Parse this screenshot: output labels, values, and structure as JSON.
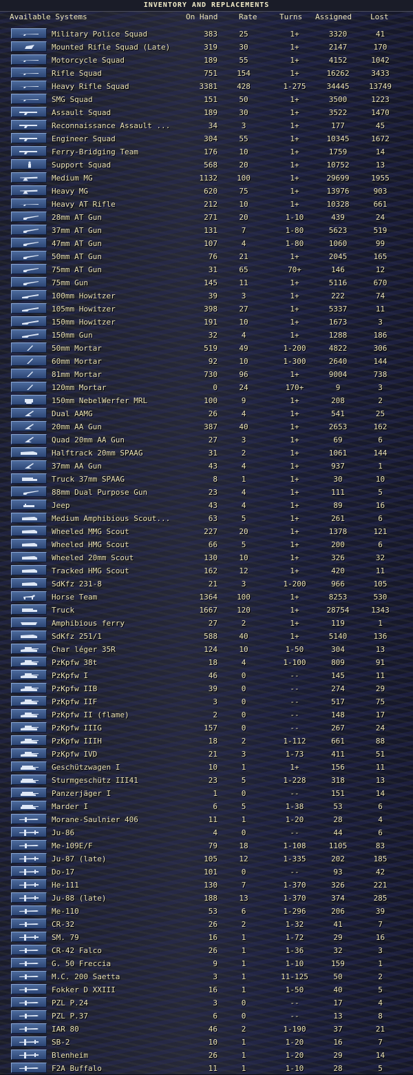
{
  "window": {
    "title": "INVENTORY AND REPLACEMENTS"
  },
  "header": {
    "systems": "Available Systems",
    "on_hand": "On Hand",
    "rate": "Rate",
    "turns": "Turns",
    "assigned": "Assigned",
    "lost": "Lost"
  },
  "rows": [
    {
      "icon": "infantry-icon",
      "name": "Military Police Squad",
      "on_hand": "383",
      "rate": "25",
      "turns": "1+",
      "assigned": "3320",
      "lost": "41"
    },
    {
      "icon": "cavalry-icon",
      "name": "Mounted Rifle Squad (Late)",
      "on_hand": "319",
      "rate": "30",
      "turns": "1+",
      "assigned": "2147",
      "lost": "170"
    },
    {
      "icon": "infantry-icon",
      "name": "Motorcycle Squad",
      "on_hand": "189",
      "rate": "55",
      "turns": "1+",
      "assigned": "4152",
      "lost": "1042"
    },
    {
      "icon": "infantry-icon",
      "name": "Rifle Squad",
      "on_hand": "751",
      "rate": "154",
      "turns": "1+",
      "assigned": "16262",
      "lost": "3433"
    },
    {
      "icon": "infantry-icon",
      "name": "Heavy Rifle Squad",
      "on_hand": "3381",
      "rate": "428",
      "turns": "1-275",
      "assigned": "34445",
      "lost": "13749"
    },
    {
      "icon": "infantry-icon",
      "name": "SMG Squad",
      "on_hand": "151",
      "rate": "50",
      "turns": "1+",
      "assigned": "3500",
      "lost": "1223"
    },
    {
      "icon": "assault-icon",
      "name": "Assault Squad",
      "on_hand": "189",
      "rate": "30",
      "turns": "1+",
      "assigned": "3522",
      "lost": "1470"
    },
    {
      "icon": "assault-icon",
      "name": "Reconnaissance Assault ...",
      "on_hand": "34",
      "rate": "3",
      "turns": "1+",
      "assigned": "177",
      "lost": "45"
    },
    {
      "icon": "assault-icon",
      "name": "Engineer Squad",
      "on_hand": "304",
      "rate": "55",
      "turns": "1+",
      "assigned": "10345",
      "lost": "1672"
    },
    {
      "icon": "assault-icon",
      "name": "Ferry-Bridging Team",
      "on_hand": "176",
      "rate": "10",
      "turns": "1+",
      "assigned": "1759",
      "lost": "14"
    },
    {
      "icon": "soldier-icon",
      "name": "Support Squad",
      "on_hand": "568",
      "rate": "20",
      "turns": "1+",
      "assigned": "10752",
      "lost": "13"
    },
    {
      "icon": "machinegun-icon",
      "name": "Medium MG",
      "on_hand": "1132",
      "rate": "100",
      "turns": "1+",
      "assigned": "29699",
      "lost": "1955"
    },
    {
      "icon": "machinegun-icon",
      "name": "Heavy MG",
      "on_hand": "620",
      "rate": "75",
      "turns": "1+",
      "assigned": "13976",
      "lost": "903"
    },
    {
      "icon": "infantry-icon",
      "name": "Heavy AT Rifle",
      "on_hand": "212",
      "rate": "10",
      "turns": "1+",
      "assigned": "10328",
      "lost": "661"
    },
    {
      "icon": "atgun-icon",
      "name": "28mm AT Gun",
      "on_hand": "271",
      "rate": "20",
      "turns": "1-10",
      "assigned": "439",
      "lost": "24"
    },
    {
      "icon": "atgun-icon",
      "name": "37mm AT Gun",
      "on_hand": "131",
      "rate": "7",
      "turns": "1-80",
      "assigned": "5623",
      "lost": "519"
    },
    {
      "icon": "atgun-icon",
      "name": "47mm AT Gun",
      "on_hand": "107",
      "rate": "4",
      "turns": "1-80",
      "assigned": "1060",
      "lost": "99"
    },
    {
      "icon": "atgun-icon",
      "name": "50mm AT Gun",
      "on_hand": "76",
      "rate": "21",
      "turns": "1+",
      "assigned": "2045",
      "lost": "165"
    },
    {
      "icon": "atgun-icon",
      "name": "75mm AT Gun",
      "on_hand": "31",
      "rate": "65",
      "turns": "70+",
      "assigned": "146",
      "lost": "12"
    },
    {
      "icon": "atgun-icon",
      "name": "75mm Gun",
      "on_hand": "145",
      "rate": "11",
      "turns": "1+",
      "assigned": "5116",
      "lost": "670"
    },
    {
      "icon": "howitzer-icon",
      "name": "100mm Howitzer",
      "on_hand": "39",
      "rate": "3",
      "turns": "1+",
      "assigned": "222",
      "lost": "74"
    },
    {
      "icon": "howitzer-icon",
      "name": "105mm Howitzer",
      "on_hand": "398",
      "rate": "27",
      "turns": "1+",
      "assigned": "5337",
      "lost": "11"
    },
    {
      "icon": "howitzer-icon",
      "name": "150mm Howitzer",
      "on_hand": "191",
      "rate": "10",
      "turns": "1+",
      "assigned": "1673",
      "lost": "3"
    },
    {
      "icon": "howitzer-icon",
      "name": "150mm Gun",
      "on_hand": "32",
      "rate": "4",
      "turns": "1+",
      "assigned": "1288",
      "lost": "186"
    },
    {
      "icon": "mortar-icon",
      "name": "50mm Mortar",
      "on_hand": "519",
      "rate": "49",
      "turns": "1-200",
      "assigned": "4822",
      "lost": "306"
    },
    {
      "icon": "mortar-icon",
      "name": "60mm Mortar",
      "on_hand": "92",
      "rate": "10",
      "turns": "1-300",
      "assigned": "2640",
      "lost": "144"
    },
    {
      "icon": "mortar-icon",
      "name": "81mm Mortar",
      "on_hand": "730",
      "rate": "96",
      "turns": "1+",
      "assigned": "9004",
      "lost": "738"
    },
    {
      "icon": "mortar-icon",
      "name": "120mm Mortar",
      "on_hand": "0",
      "rate": "24",
      "turns": "170+",
      "assigned": "9",
      "lost": "3"
    },
    {
      "icon": "rocket-icon",
      "name": "150mm NebelWerfer MRL",
      "on_hand": "100",
      "rate": "9",
      "turns": "1+",
      "assigned": "208",
      "lost": "2"
    },
    {
      "icon": "aa-gun-icon",
      "name": "Dual AAMG",
      "on_hand": "26",
      "rate": "4",
      "turns": "1+",
      "assigned": "541",
      "lost": "25"
    },
    {
      "icon": "aa-gun-icon",
      "name": "20mm AA Gun",
      "on_hand": "387",
      "rate": "40",
      "turns": "1+",
      "assigned": "2653",
      "lost": "162"
    },
    {
      "icon": "aa-gun-icon",
      "name": "Quad 20mm AA Gun",
      "on_hand": "27",
      "rate": "3",
      "turns": "1+",
      "assigned": "69",
      "lost": "6"
    },
    {
      "icon": "halftrack-icon",
      "name": "Halftrack 20mm SPAAG",
      "on_hand": "31",
      "rate": "2",
      "turns": "1+",
      "assigned": "1061",
      "lost": "144"
    },
    {
      "icon": "aa-gun-icon",
      "name": "37mm AA Gun",
      "on_hand": "43",
      "rate": "4",
      "turns": "1+",
      "assigned": "937",
      "lost": "1"
    },
    {
      "icon": "truck-icon",
      "name": "Truck 37mm SPAAG",
      "on_hand": "8",
      "rate": "1",
      "turns": "1+",
      "assigned": "30",
      "lost": "10"
    },
    {
      "icon": "atgun-icon",
      "name": "88mm Dual Purpose Gun",
      "on_hand": "23",
      "rate": "4",
      "turns": "1+",
      "assigned": "111",
      "lost": "5"
    },
    {
      "icon": "jeep-icon",
      "name": "Jeep",
      "on_hand": "43",
      "rate": "4",
      "turns": "1+",
      "assigned": "89",
      "lost": "16"
    },
    {
      "icon": "armored-car-icon",
      "name": "Medium Amphibious Scout...",
      "on_hand": "63",
      "rate": "5",
      "turns": "1+",
      "assigned": "261",
      "lost": "6"
    },
    {
      "icon": "armored-car-icon",
      "name": "Wheeled MMG Scout",
      "on_hand": "227",
      "rate": "20",
      "turns": "1+",
      "assigned": "1378",
      "lost": "121"
    },
    {
      "icon": "armored-car-icon",
      "name": "Wheeled HMG Scout",
      "on_hand": "66",
      "rate": "5",
      "turns": "1+",
      "assigned": "200",
      "lost": "6"
    },
    {
      "icon": "armored-car-icon",
      "name": "Wheeled 20mm Scout",
      "on_hand": "130",
      "rate": "10",
      "turns": "1+",
      "assigned": "326",
      "lost": "32"
    },
    {
      "icon": "armored-car-icon",
      "name": "Tracked HMG Scout",
      "on_hand": "162",
      "rate": "12",
      "turns": "1+",
      "assigned": "420",
      "lost": "11"
    },
    {
      "icon": "armored-car-icon",
      "name": "SdKfz 231-8",
      "on_hand": "21",
      "rate": "3",
      "turns": "1-200",
      "assigned": "966",
      "lost": "105"
    },
    {
      "icon": "horse-icon",
      "name": "Horse Team",
      "on_hand": "1364",
      "rate": "100",
      "turns": "1+",
      "assigned": "8253",
      "lost": "530"
    },
    {
      "icon": "truck-icon",
      "name": "Truck",
      "on_hand": "1667",
      "rate": "120",
      "turns": "1+",
      "assigned": "28754",
      "lost": "1343"
    },
    {
      "icon": "ferry-icon",
      "name": "Amphibious ferry",
      "on_hand": "27",
      "rate": "2",
      "turns": "1+",
      "assigned": "119",
      "lost": "1"
    },
    {
      "icon": "halftrack-icon",
      "name": "SdKfz 251/1",
      "on_hand": "588",
      "rate": "40",
      "turns": "1+",
      "assigned": "5140",
      "lost": "136"
    },
    {
      "icon": "tank-icon",
      "name": "Char léger 35R",
      "on_hand": "124",
      "rate": "10",
      "turns": "1-50",
      "assigned": "304",
      "lost": "13"
    },
    {
      "icon": "tank-icon",
      "name": "PzKpfw 38t",
      "on_hand": "18",
      "rate": "4",
      "turns": "1-100",
      "assigned": "809",
      "lost": "91"
    },
    {
      "icon": "tank-icon",
      "name": "PzKpfw I",
      "on_hand": "46",
      "rate": "0",
      "turns": "--",
      "assigned": "145",
      "lost": "11"
    },
    {
      "icon": "tank-icon",
      "name": "PzKpfw IIB",
      "on_hand": "39",
      "rate": "0",
      "turns": "--",
      "assigned": "274",
      "lost": "29"
    },
    {
      "icon": "tank-icon",
      "name": "PzKpfw IIF",
      "on_hand": "3",
      "rate": "0",
      "turns": "--",
      "assigned": "517",
      "lost": "75"
    },
    {
      "icon": "tank-icon",
      "name": "PzKpfw II (flame)",
      "on_hand": "2",
      "rate": "0",
      "turns": "--",
      "assigned": "148",
      "lost": "17"
    },
    {
      "icon": "tank-icon",
      "name": "PzKpfw IIIG",
      "on_hand": "157",
      "rate": "0",
      "turns": "--",
      "assigned": "267",
      "lost": "24"
    },
    {
      "icon": "tank-icon",
      "name": "PzKpfw IIIH",
      "on_hand": "18",
      "rate": "2",
      "turns": "1-112",
      "assigned": "661",
      "lost": "88"
    },
    {
      "icon": "tank-icon",
      "name": "PzKpfw IVD",
      "on_hand": "21",
      "rate": "3",
      "turns": "1-73",
      "assigned": "411",
      "lost": "51"
    },
    {
      "icon": "assault-gun-icon",
      "name": "Geschützwagen I",
      "on_hand": "10",
      "rate": "1",
      "turns": "1+",
      "assigned": "156",
      "lost": "11"
    },
    {
      "icon": "assault-gun-icon",
      "name": "Sturmgeschütz III41",
      "on_hand": "23",
      "rate": "5",
      "turns": "1-228",
      "assigned": "318",
      "lost": "13"
    },
    {
      "icon": "assault-gun-icon",
      "name": "Panzerjäger I",
      "on_hand": "1",
      "rate": "0",
      "turns": "--",
      "assigned": "151",
      "lost": "14"
    },
    {
      "icon": "assault-gun-icon",
      "name": "Marder I",
      "on_hand": "6",
      "rate": "5",
      "turns": "1-38",
      "assigned": "53",
      "lost": "6"
    },
    {
      "icon": "fighter-icon",
      "name": "Morane-Saulnier 406",
      "on_hand": "11",
      "rate": "1",
      "turns": "1-20",
      "assigned": "28",
      "lost": "4"
    },
    {
      "icon": "bomber-icon",
      "name": "Ju-86",
      "on_hand": "4",
      "rate": "0",
      "turns": "--",
      "assigned": "44",
      "lost": "6"
    },
    {
      "icon": "fighter-icon",
      "name": "Me-109E/F",
      "on_hand": "79",
      "rate": "18",
      "turns": "1-108",
      "assigned": "1105",
      "lost": "83"
    },
    {
      "icon": "bomber-icon",
      "name": "Ju-87 (late)",
      "on_hand": "105",
      "rate": "12",
      "turns": "1-335",
      "assigned": "202",
      "lost": "185"
    },
    {
      "icon": "bomber-icon",
      "name": "Do-17",
      "on_hand": "101",
      "rate": "0",
      "turns": "--",
      "assigned": "93",
      "lost": "42"
    },
    {
      "icon": "bomber-icon",
      "name": "He-111",
      "on_hand": "130",
      "rate": "7",
      "turns": "1-370",
      "assigned": "326",
      "lost": "221"
    },
    {
      "icon": "bomber-icon",
      "name": "Ju-88 (late)",
      "on_hand": "188",
      "rate": "13",
      "turns": "1-370",
      "assigned": "374",
      "lost": "285"
    },
    {
      "icon": "fighter-icon",
      "name": "Me-110",
      "on_hand": "53",
      "rate": "6",
      "turns": "1-296",
      "assigned": "206",
      "lost": "39"
    },
    {
      "icon": "fighter-icon",
      "name": "CR-32",
      "on_hand": "26",
      "rate": "2",
      "turns": "1-32",
      "assigned": "41",
      "lost": "7"
    },
    {
      "icon": "bomber-icon",
      "name": "SM. 79",
      "on_hand": "16",
      "rate": "1",
      "turns": "1-72",
      "assigned": "29",
      "lost": "16"
    },
    {
      "icon": "fighter-icon",
      "name": "CR-42 Falco",
      "on_hand": "26",
      "rate": "1",
      "turns": "1-36",
      "assigned": "32",
      "lost": "3"
    },
    {
      "icon": "fighter-icon",
      "name": "G. 50 Freccia",
      "on_hand": "9",
      "rate": "1",
      "turns": "1-10",
      "assigned": "159",
      "lost": "1"
    },
    {
      "icon": "fighter-icon",
      "name": "M.C. 200 Saetta",
      "on_hand": "3",
      "rate": "1",
      "turns": "11-125",
      "assigned": "50",
      "lost": "2"
    },
    {
      "icon": "fighter-icon",
      "name": "Fokker D XXIII",
      "on_hand": "16",
      "rate": "1",
      "turns": "1-50",
      "assigned": "40",
      "lost": "5"
    },
    {
      "icon": "fighter-icon",
      "name": "PZL P.24",
      "on_hand": "3",
      "rate": "0",
      "turns": "--",
      "assigned": "17",
      "lost": "4"
    },
    {
      "icon": "fighter-icon",
      "name": "PZL P.37",
      "on_hand": "6",
      "rate": "0",
      "turns": "--",
      "assigned": "13",
      "lost": "8"
    },
    {
      "icon": "fighter-icon",
      "name": "IAR 80",
      "on_hand": "46",
      "rate": "2",
      "turns": "1-190",
      "assigned": "37",
      "lost": "21"
    },
    {
      "icon": "bomber-icon",
      "name": "SB-2",
      "on_hand": "10",
      "rate": "1",
      "turns": "1-20",
      "assigned": "16",
      "lost": "7"
    },
    {
      "icon": "bomber-icon",
      "name": "Blenheim",
      "on_hand": "26",
      "rate": "1",
      "turns": "1-20",
      "assigned": "29",
      "lost": "14"
    },
    {
      "icon": "fighter-icon",
      "name": "F2A Buffalo",
      "on_hand": "11",
      "rate": "1",
      "turns": "1-10",
      "assigned": "28",
      "lost": "5"
    }
  ]
}
